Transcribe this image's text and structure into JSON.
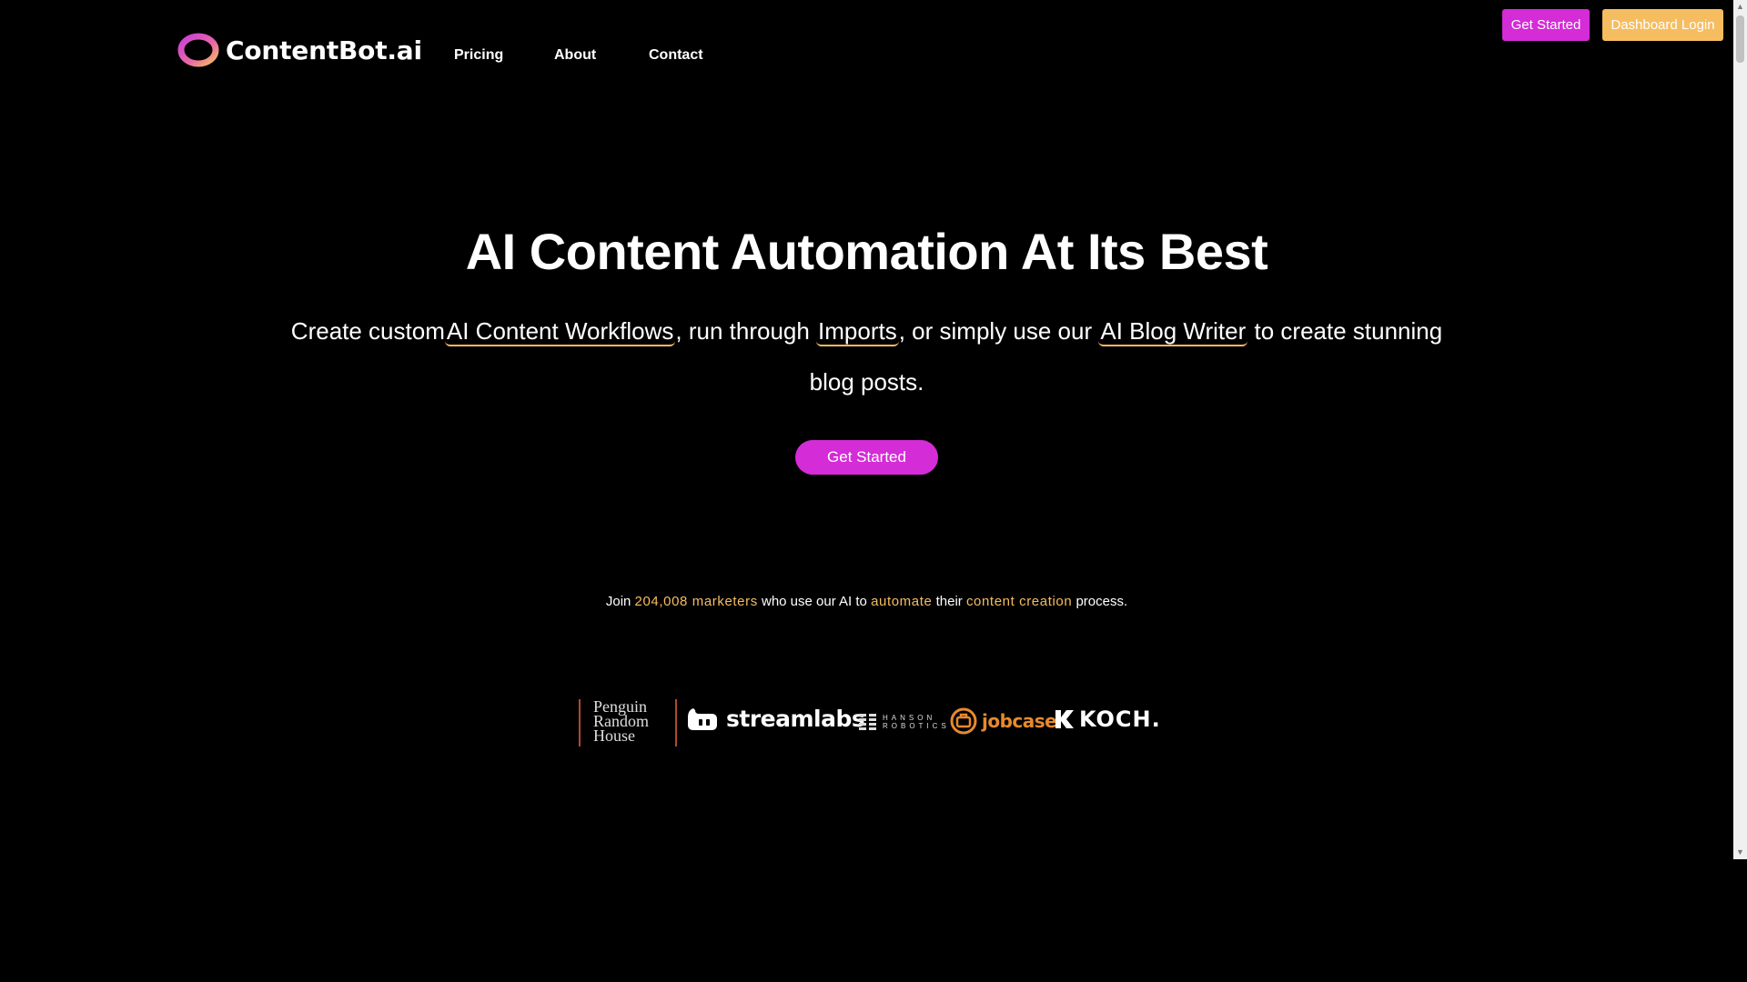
{
  "header": {
    "logo_text": "ContentBot.ai",
    "nav": [
      {
        "label": "Pricing"
      },
      {
        "label": "About"
      },
      {
        "label": "Contact"
      }
    ],
    "get_started_label": "Get Started",
    "dashboard_login_label": "Dashboard Login"
  },
  "hero": {
    "title": "AI Content Automation At Its Best",
    "sub_part1": "Create custom",
    "link1": "AI Content Workflows",
    "sub_part2": ", run through ",
    "link2": "Imports",
    "sub_part3": ", or simply use our ",
    "link3": "AI Blog Writer",
    "sub_part4": " to create stunning blog posts.",
    "cta_label": "Get Started"
  },
  "social_proof": {
    "p1": "Join ",
    "count": "204,008 marketers",
    "p2": " who use our AI to ",
    "word1": "automate",
    "p3": " their ",
    "word2": "content creation",
    "p4": " process."
  },
  "logos": {
    "prh": [
      "Penguin",
      "Random",
      "House"
    ],
    "streamlabs": "streamlabs",
    "hanson": [
      "HANSON",
      "ROBOTICS"
    ],
    "jobcase": "jobcase",
    "koch": "KOCH."
  },
  "colors": {
    "accent_pink": "#d42cd6",
    "accent_orange": "#f6bd60",
    "background": "#000000"
  }
}
